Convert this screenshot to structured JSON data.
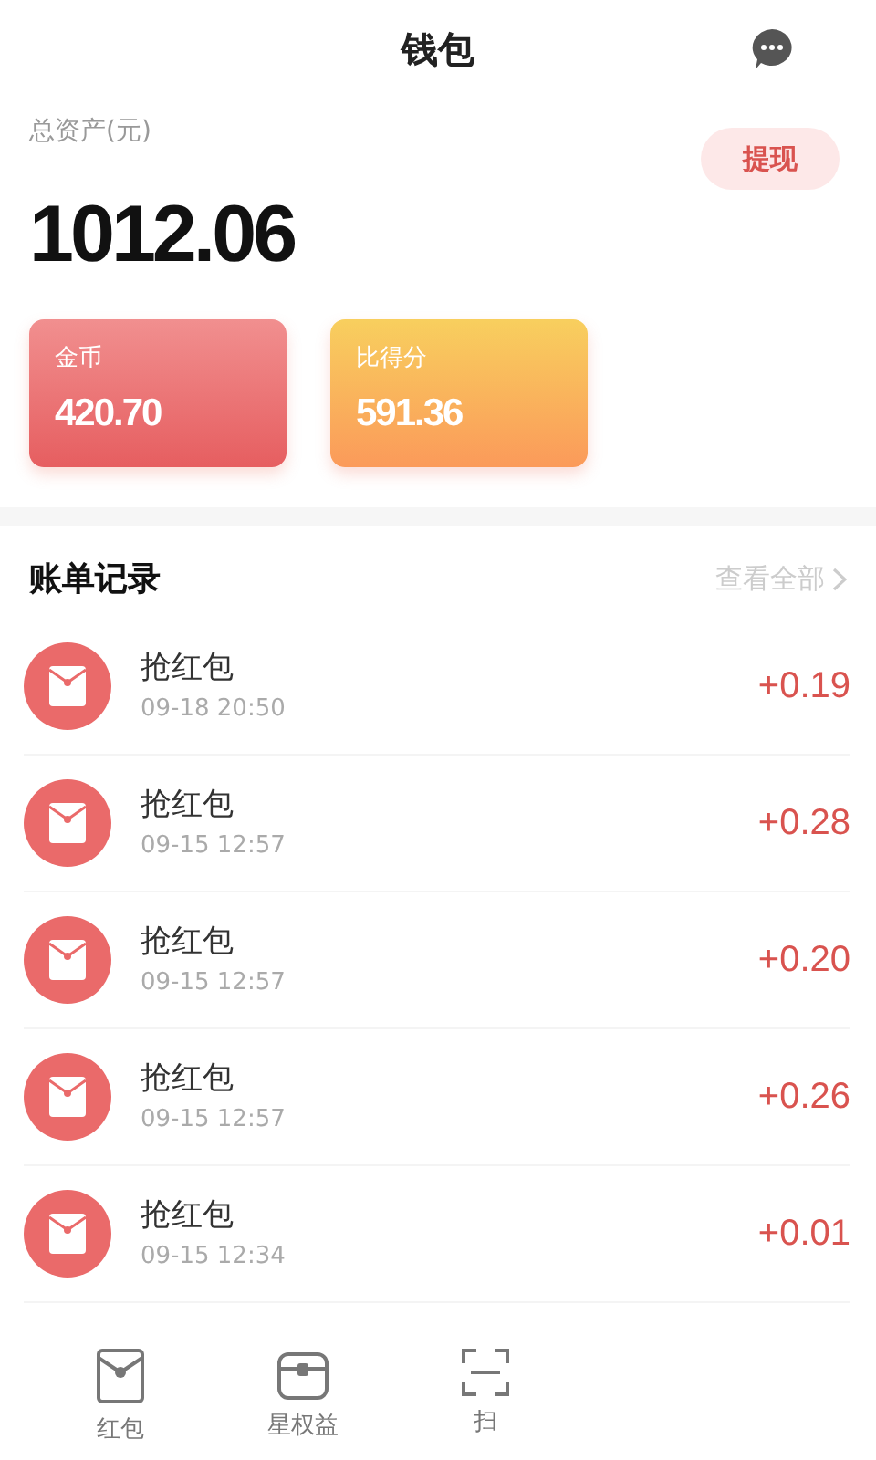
{
  "header": {
    "title": "钱包"
  },
  "assets": {
    "label": "总资产(元)",
    "amount": "1012.06",
    "withdraw_button": "提现"
  },
  "balances": [
    {
      "kind": "coin",
      "label": "金币",
      "value": "420.70"
    },
    {
      "kind": "points",
      "label": "比得分",
      "value": "591.36"
    }
  ],
  "records": {
    "title": "账单记录",
    "view_all": "查看全部",
    "items": [
      {
        "title": "抢红包",
        "time": "09-18 20:50",
        "amount": "+0.19"
      },
      {
        "title": "抢红包",
        "time": "09-15 12:57",
        "amount": "+0.28"
      },
      {
        "title": "抢红包",
        "time": "09-15 12:57",
        "amount": "+0.20"
      },
      {
        "title": "抢红包",
        "time": "09-15 12:57",
        "amount": "+0.26"
      },
      {
        "title": "抢红包",
        "time": "09-15 12:34",
        "amount": "+0.01"
      }
    ]
  },
  "tab_bar": [
    {
      "kind": "envelope",
      "label": "红包"
    },
    {
      "kind": "chest",
      "label": "星权益"
    },
    {
      "kind": "scan",
      "label": "扫"
    }
  ]
}
